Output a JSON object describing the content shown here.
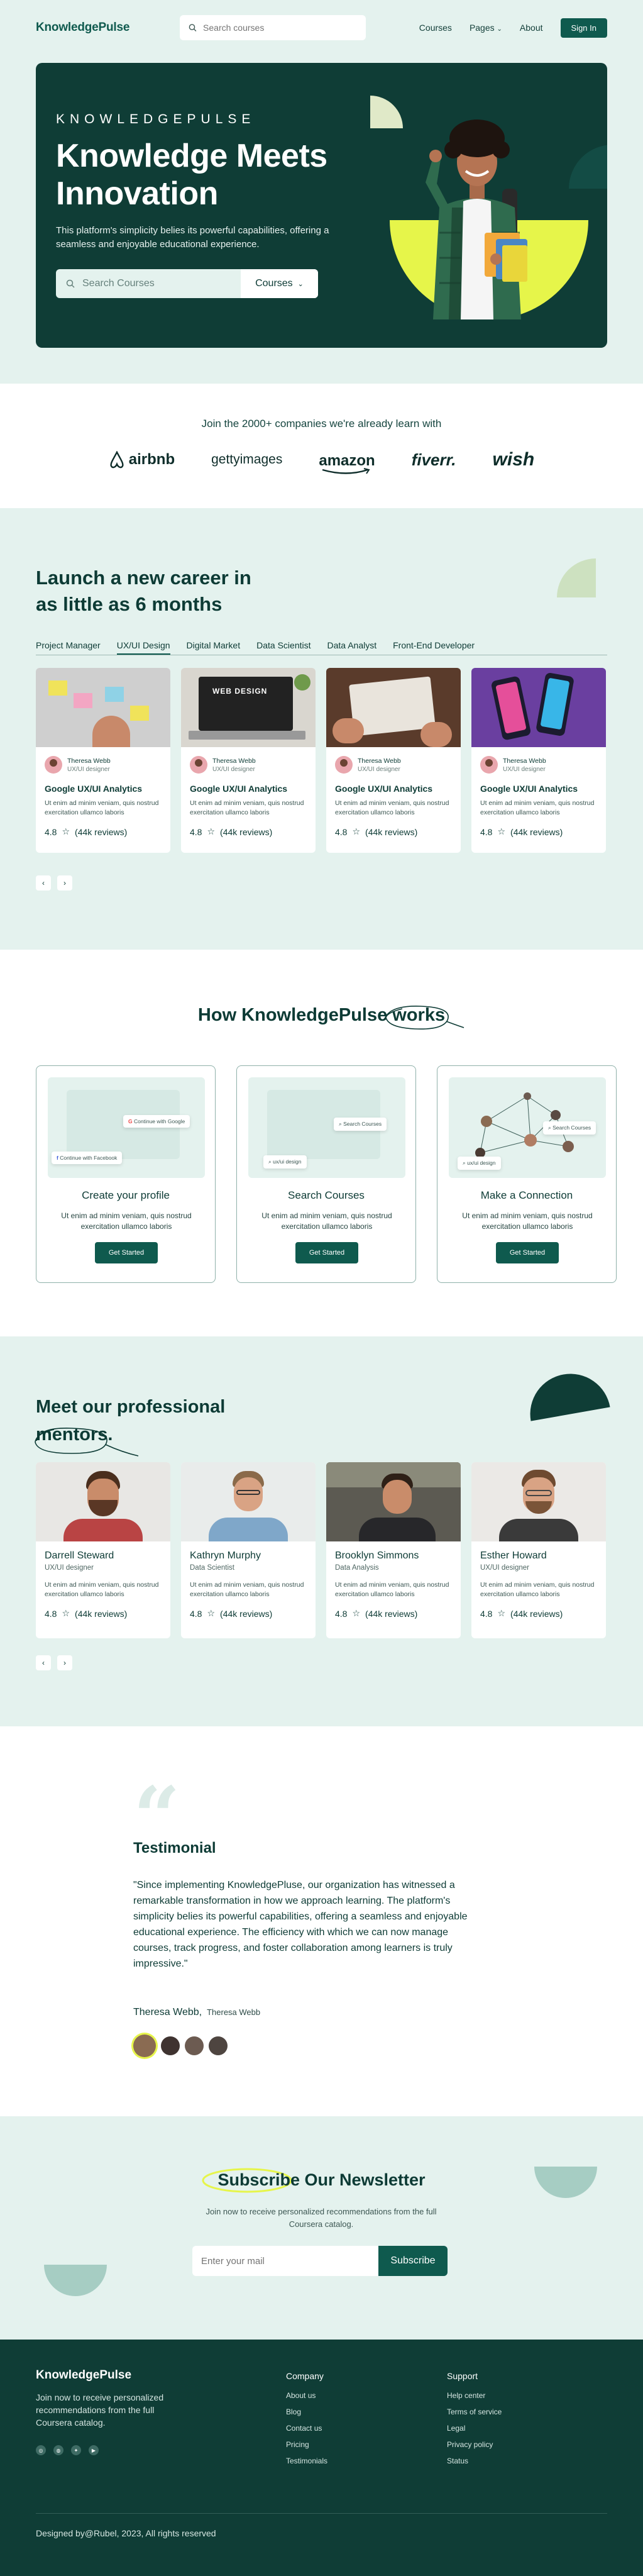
{
  "nav": {
    "brand": "KnowledgePulse",
    "search_placeholder": "Search courses",
    "links": [
      "Courses",
      "Pages",
      "About"
    ],
    "signin": "Sign In"
  },
  "hero": {
    "eyebrow": "KNOWLEDGEPULSE",
    "title": "Knowledge Meets Innovation",
    "subtitle": "This platform's simplicity belies its powerful capabilities, offering a seamless and enjoyable educational experience.",
    "search_placeholder": "Search Courses",
    "dropdown": "Courses"
  },
  "companies": {
    "heading": "Join the 2000+ companies we're already learn with",
    "logos": [
      "airbnb",
      "gettyimages",
      "amazon",
      "fiverr.",
      "wish"
    ]
  },
  "career": {
    "heading": "Launch a new career in as little as 6 months",
    "tabs": [
      "Project Manager",
      "UX/UI Design",
      "Digital Market",
      "Data Scientist",
      "Data Analyst",
      "Front-End Developer"
    ],
    "active_tab": "UX/UI Design",
    "cards": [
      {
        "author": "Theresa Webb",
        "role": "UX/UI designer",
        "title": "Google UX/UI Analytics",
        "desc": "Ut enim ad minim veniam, quis nostrud exercitation ullamco laboris",
        "rating": "4.8",
        "reviews": "(44k reviews)"
      },
      {
        "author": "Theresa Webb",
        "role": "UX/UI designer",
        "title": "Google UX/UI Analytics",
        "desc": "Ut enim ad minim veniam, quis nostrud exercitation ullamco laboris",
        "rating": "4.8",
        "reviews": "(44k reviews)"
      },
      {
        "author": "Theresa Webb",
        "role": "UX/UI designer",
        "title": "Google UX/UI Analytics",
        "desc": "Ut enim ad minim veniam, quis nostrud exercitation ullamco laboris",
        "rating": "4.8",
        "reviews": "(44k reviews)"
      },
      {
        "author": "Theresa Webb",
        "role": "UX/UI designer",
        "title": "Google UX/UI Analytics",
        "desc": "Ut enim ad minim veniam, quis nostrud exercitation ullamco laboris",
        "rating": "4.8",
        "reviews": "(44k reviews)"
      }
    ],
    "card_image_text": "WEB DESIGN"
  },
  "how": {
    "heading": "How KnowledgePulse works",
    "cards": [
      {
        "title": "Create your profile",
        "desc": "Ut enim ad minim veniam, quis nostrud exercitation ullamco laboris",
        "button": "Get Started",
        "chips": [
          "Continue with Google",
          "Continue with Facebook"
        ]
      },
      {
        "title": "Search Courses",
        "desc": "Ut enim ad minim veniam, quis nostrud exercitation ullamco laboris",
        "button": "Get Started",
        "chips": [
          "Search Courses",
          "ux/ui design"
        ]
      },
      {
        "title": "Make a Connection",
        "desc": "Ut enim ad minim veniam, quis nostrud exercitation ullamco laboris",
        "button": "Get Started",
        "chips": [
          "Search Courses",
          "ux/ui design"
        ]
      }
    ]
  },
  "mentors": {
    "heading": "Meet our professional mentors.",
    "cards": [
      {
        "name": "Darrell Steward",
        "role": "UX/UI designer",
        "desc": "Ut enim ad minim veniam, quis nostrud exercitation ullamco laboris",
        "rating": "4.8",
        "reviews": "(44k reviews)"
      },
      {
        "name": "Kathryn Murphy",
        "role": "Data Scientist",
        "desc": "Ut enim ad minim veniam, quis nostrud exercitation ullamco laboris",
        "rating": "4.8",
        "reviews": "(44k reviews)"
      },
      {
        "name": "Brooklyn Simmons",
        "role": "Data Analysis",
        "desc": "Ut enim ad minim veniam, quis nostrud exercitation ullamco laboris",
        "rating": "4.8",
        "reviews": "(44k reviews)"
      },
      {
        "name": "Esther Howard",
        "role": "UX/UI designer",
        "desc": "Ut enim ad minim veniam, quis nostrud exercitation ullamco laboris",
        "rating": "4.8",
        "reviews": "(44k reviews)"
      }
    ]
  },
  "testimonial": {
    "heading": "Testimonial",
    "quote": "\"Since implementing KnowledgePluse, our organization has witnessed a remarkable transformation in how we approach learning. The platform's simplicity belies its powerful capabilities, offering a seamless and enjoyable educational experience. The efficiency with which we can now manage courses, track progress, and foster collaboration among learners is truly impressive.\"",
    "name": "Theresa Webb,",
    "subname": "Theresa Webb"
  },
  "newsletter": {
    "heading": "Subscribe Our Newsletter",
    "text": "Join now to receive personalized recommendations from the full Coursera catalog.",
    "placeholder": "Enter your mail",
    "button": "Subscribe"
  },
  "footer": {
    "brand": "KnowledgePulse",
    "text": "Join now to receive personalized recommendations from the full Coursera catalog.",
    "company_title": "Company",
    "company_links": [
      "About us",
      "Blog",
      "Contact us",
      "Pricing",
      "Testimonials"
    ],
    "support_title": "Support",
    "support_links": [
      "Help center",
      "Terms of service",
      "Legal",
      "Privacy policy",
      "Status"
    ],
    "copyright": "Designed by@Rubel, 2023, All rights reserved"
  },
  "colors": {
    "brand_dark": "#0f3d36",
    "brand": "#0f5a4e",
    "mint_bg": "#e4f2ee",
    "accent_yellow": "#e6f54a"
  }
}
